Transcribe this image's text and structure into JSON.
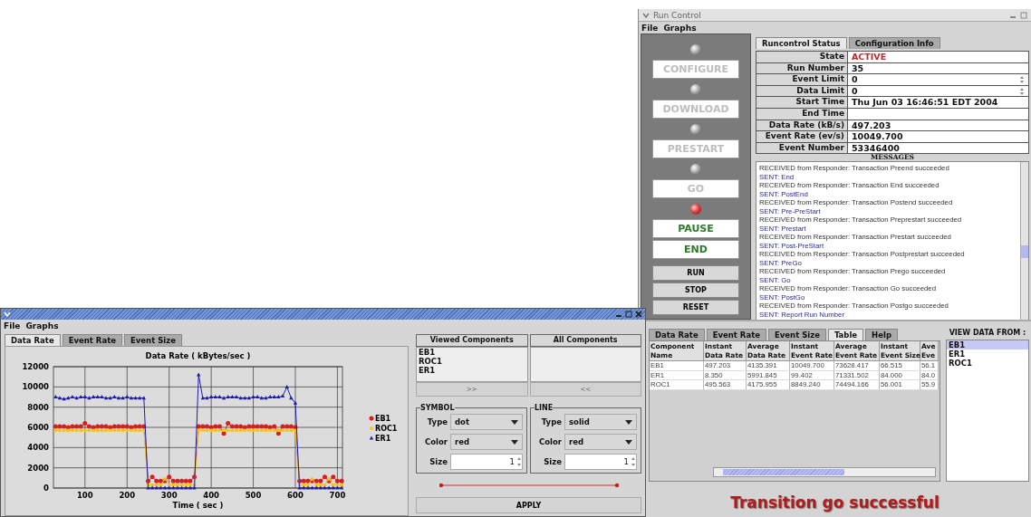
{
  "run_control": {
    "window": {
      "title": "Run Control"
    },
    "menu": [
      "File",
      "Graphs"
    ],
    "transitions": [
      {
        "label": "CONFIGURE",
        "enabled": false,
        "lit": false
      },
      {
        "label": "DOWNLOAD",
        "enabled": false,
        "lit": false
      },
      {
        "label": "PRESTART",
        "enabled": false,
        "lit": false
      },
      {
        "label": "GO",
        "enabled": false,
        "lit": false
      },
      {
        "label": "PAUSE",
        "enabled": true,
        "lit": true
      },
      {
        "label": "END",
        "enabled": true
      }
    ],
    "commands": [
      "RUN",
      "STOP",
      "RESET"
    ],
    "tabs": [
      {
        "label": "Runcontrol Status",
        "selected": true
      },
      {
        "label": "Configuration Info",
        "selected": false
      }
    ],
    "status": [
      {
        "label": "State",
        "value": "ACTIVE",
        "kind": "state"
      },
      {
        "label": "Run Number",
        "value": "35",
        "kind": "text"
      },
      {
        "label": "Event Limit",
        "value": "0",
        "kind": "spinner"
      },
      {
        "label": "Data Limit",
        "value": "0",
        "kind": "spinner"
      },
      {
        "label": "Start Time",
        "value": "Thu Jun 03 16:46:51 EDT 2004",
        "kind": "text"
      },
      {
        "label": "End Time",
        "kind": "text"
      },
      {
        "label": "Data Rate (kB/s)",
        "value": "497.203",
        "kind": "text"
      },
      {
        "label": "Event Rate (ev/s)",
        "value": "10049.700",
        "kind": "text"
      },
      {
        "label": "Event Number",
        "value": "53346400",
        "kind": "text"
      }
    ],
    "messages_title": "MESSAGES",
    "messages": [
      {
        "kind": "received",
        "text": "RECEIVED from Responder: Transaction Preend succeeded"
      },
      {
        "kind": "sent",
        "text": "SENT: End"
      },
      {
        "kind": "received",
        "text": "RECEIVED from Responder: Transaction End succeeded"
      },
      {
        "kind": "sent",
        "text": "SENT: PostEnd"
      },
      {
        "kind": "received",
        "text": "RECEIVED from Responder: Transaction Postend succeeded"
      },
      {
        "kind": "sent",
        "text": "SENT: Pre-PreStart"
      },
      {
        "kind": "received",
        "text": "RECEIVED from Responder: Transaction Preprestart succeeded"
      },
      {
        "kind": "sent",
        "text": "SENT: Prestart"
      },
      {
        "kind": "received",
        "text": "RECEIVED from Responder: Transaction Prestart succeeded"
      },
      {
        "kind": "sent",
        "text": "SENT: Post-PreStart"
      },
      {
        "kind": "received",
        "text": "RECEIVED from Responder: Transaction Postprestart succeeded"
      },
      {
        "kind": "sent",
        "text": "SENT: PreGo"
      },
      {
        "kind": "received",
        "text": "RECEIVED from Responder: Transaction Prego succeeded"
      },
      {
        "kind": "sent",
        "text": "SENT: Go"
      },
      {
        "kind": "received",
        "text": "RECEIVED from Responder: Transaction Go succeeded"
      },
      {
        "kind": "sent",
        "text": "SENT: PostGo"
      },
      {
        "kind": "received",
        "text": "RECEIVED from Responder: Transaction Postgo succeeded"
      },
      {
        "kind": "sent",
        "text": "SENT: Report Run Number"
      }
    ],
    "data_tabs": [
      {
        "label": "Data Rate",
        "selected": false
      },
      {
        "label": "Event Rate",
        "selected": false
      },
      {
        "label": "Event Size",
        "selected": false
      },
      {
        "label": "Table",
        "selected": true
      },
      {
        "label": "Help",
        "selected": false
      }
    ],
    "table": {
      "columns": [
        {
          "lines": [
            "Component",
            "Name"
          ]
        },
        {
          "lines": [
            "Instant",
            "Data Rate"
          ]
        },
        {
          "lines": [
            "Average",
            "Data Rate"
          ]
        },
        {
          "lines": [
            "Instant",
            "Event Rate"
          ]
        },
        {
          "lines": [
            "Average",
            "Event Rate"
          ]
        },
        {
          "lines": [
            "Instant",
            "Event Size"
          ]
        },
        {
          "lines": [
            "Ave",
            "Eve"
          ]
        }
      ],
      "rows": [
        [
          "EB1",
          "497.203",
          "4135.391",
          "10049.700",
          "73628.417",
          "66.515",
          "56.1"
        ],
        [
          "ER1",
          "8.350",
          "5991.845",
          "99.402",
          "71331.502",
          "84.000",
          "84.0"
        ],
        [
          "ROC1",
          "495.563",
          "4175.955",
          "8849.240",
          "74494.166",
          "56.001",
          "55.9"
        ]
      ]
    },
    "view_data": {
      "title": "VIEW DATA FROM :",
      "items": [
        {
          "label": "EB1",
          "selected": true
        },
        {
          "label": "ER1",
          "selected": false
        },
        {
          "label": "ROC1",
          "selected": false
        }
      ]
    },
    "status_message": "Transition go successful"
  },
  "graph_window": {
    "menu": [
      "File",
      "Graphs"
    ],
    "tabs": [
      {
        "label": "Data Rate",
        "selected": true
      },
      {
        "label": "Event Rate",
        "selected": false
      },
      {
        "label": "Event Size",
        "selected": false
      }
    ],
    "chart_data": {
      "type": "line",
      "title": "Data Rate  ( kBytes/sec )",
      "xlabel": "Time  ( sec )",
      "grid": true,
      "legend": "right",
      "xlim": [
        25,
        712
      ],
      "ylim": [
        0,
        12000
      ],
      "xticks": [
        100,
        200,
        300,
        400,
        500,
        600,
        700
      ],
      "yticks": [
        0,
        2000,
        4000,
        6000,
        8000,
        10000,
        12000
      ],
      "x": [
        30,
        40,
        50,
        60,
        70,
        80,
        90,
        100,
        110,
        120,
        130,
        140,
        150,
        160,
        170,
        180,
        190,
        200,
        210,
        220,
        230,
        240,
        250,
        260,
        270,
        280,
        290,
        300,
        310,
        320,
        330,
        340,
        350,
        360,
        370,
        380,
        390,
        400,
        410,
        420,
        430,
        440,
        450,
        460,
        470,
        480,
        490,
        500,
        510,
        520,
        530,
        540,
        550,
        560,
        570,
        580,
        590,
        600,
        610,
        620,
        630,
        640,
        650,
        660,
        670,
        680,
        690,
        700,
        710
      ],
      "series": [
        {
          "name": "EB1",
          "color": "#d42020",
          "values": [
            6100,
            6100,
            6100,
            6000,
            6100,
            6100,
            6100,
            6400,
            6100,
            6000,
            6100,
            6100,
            6100,
            6000,
            6100,
            6100,
            6100,
            6100,
            6000,
            6100,
            6100,
            6100,
            700,
            1100,
            700,
            700,
            700,
            1100,
            700,
            700,
            700,
            700,
            700,
            1100,
            6100,
            6100,
            6100,
            6000,
            6100,
            6100,
            5400,
            6400,
            6100,
            6100,
            6100,
            6000,
            6100,
            6100,
            6100,
            6100,
            6100,
            6000,
            6100,
            5400,
            6100,
            6100,
            6100,
            6000,
            700,
            700,
            700,
            700,
            700,
            700,
            1100,
            700,
            1100,
            700,
            700
          ]
        },
        {
          "name": "ROC1",
          "color": "#f5c518",
          "marker": "square",
          "values": [
            5700,
            5700,
            5700,
            5700,
            5700,
            5700,
            5700,
            5700,
            5700,
            5700,
            5700,
            5700,
            5700,
            5700,
            5700,
            5700,
            5700,
            5700,
            5700,
            5700,
            5700,
            5700,
            300,
            300,
            300,
            300,
            900,
            300,
            300,
            300,
            300,
            300,
            300,
            300,
            5700,
            5700,
            5700,
            5700,
            5700,
            5700,
            5700,
            5700,
            5700,
            5700,
            5700,
            5700,
            5700,
            5700,
            5700,
            5700,
            5700,
            5700,
            5700,
            5700,
            5700,
            5700,
            5700,
            5700,
            300,
            300,
            300,
            900,
            300,
            300,
            300,
            900,
            300,
            300,
            300
          ]
        },
        {
          "name": "ER1",
          "color": "#1c1ca8",
          "marker": "triangle",
          "values": [
            9000,
            8900,
            8800,
            8900,
            9000,
            8900,
            9000,
            9000,
            8900,
            9000,
            9000,
            9000,
            8900,
            8900,
            9000,
            8900,
            8900,
            9000,
            8900,
            8900,
            8900,
            8900,
            0,
            0,
            0,
            0,
            0,
            0,
            0,
            0,
            0,
            0,
            0,
            0,
            11200,
            8900,
            8900,
            9000,
            9000,
            9000,
            8900,
            9000,
            9000,
            9000,
            8900,
            8900,
            8900,
            9000,
            9000,
            8900,
            8900,
            9000,
            9000,
            9000,
            9100,
            10000,
            8900,
            8400,
            0,
            0,
            0,
            0,
            0,
            0,
            0,
            0,
            0,
            0,
            0
          ]
        }
      ]
    },
    "components": {
      "columns": [
        "Viewed Components",
        "All Components"
      ],
      "viewed": [
        "EB1",
        "ROC1",
        "ER1"
      ],
      "buttons": [
        ">>",
        "<<"
      ]
    },
    "groups": [
      {
        "title": "SYMBOL",
        "fields": [
          {
            "label": "Type",
            "value": "dot",
            "kind": "combo"
          },
          {
            "label": "Color",
            "value": "red",
            "kind": "combo"
          },
          {
            "label": "Size",
            "value": "1",
            "kind": "spinner"
          }
        ]
      },
      {
        "title": "LINE",
        "fields": [
          {
            "label": "Type",
            "value": "solid",
            "kind": "combo"
          },
          {
            "label": "Color",
            "value": "red",
            "kind": "combo"
          },
          {
            "label": "Size",
            "value": "1",
            "kind": "spinner"
          }
        ]
      }
    ],
    "apply": "APPLY"
  }
}
